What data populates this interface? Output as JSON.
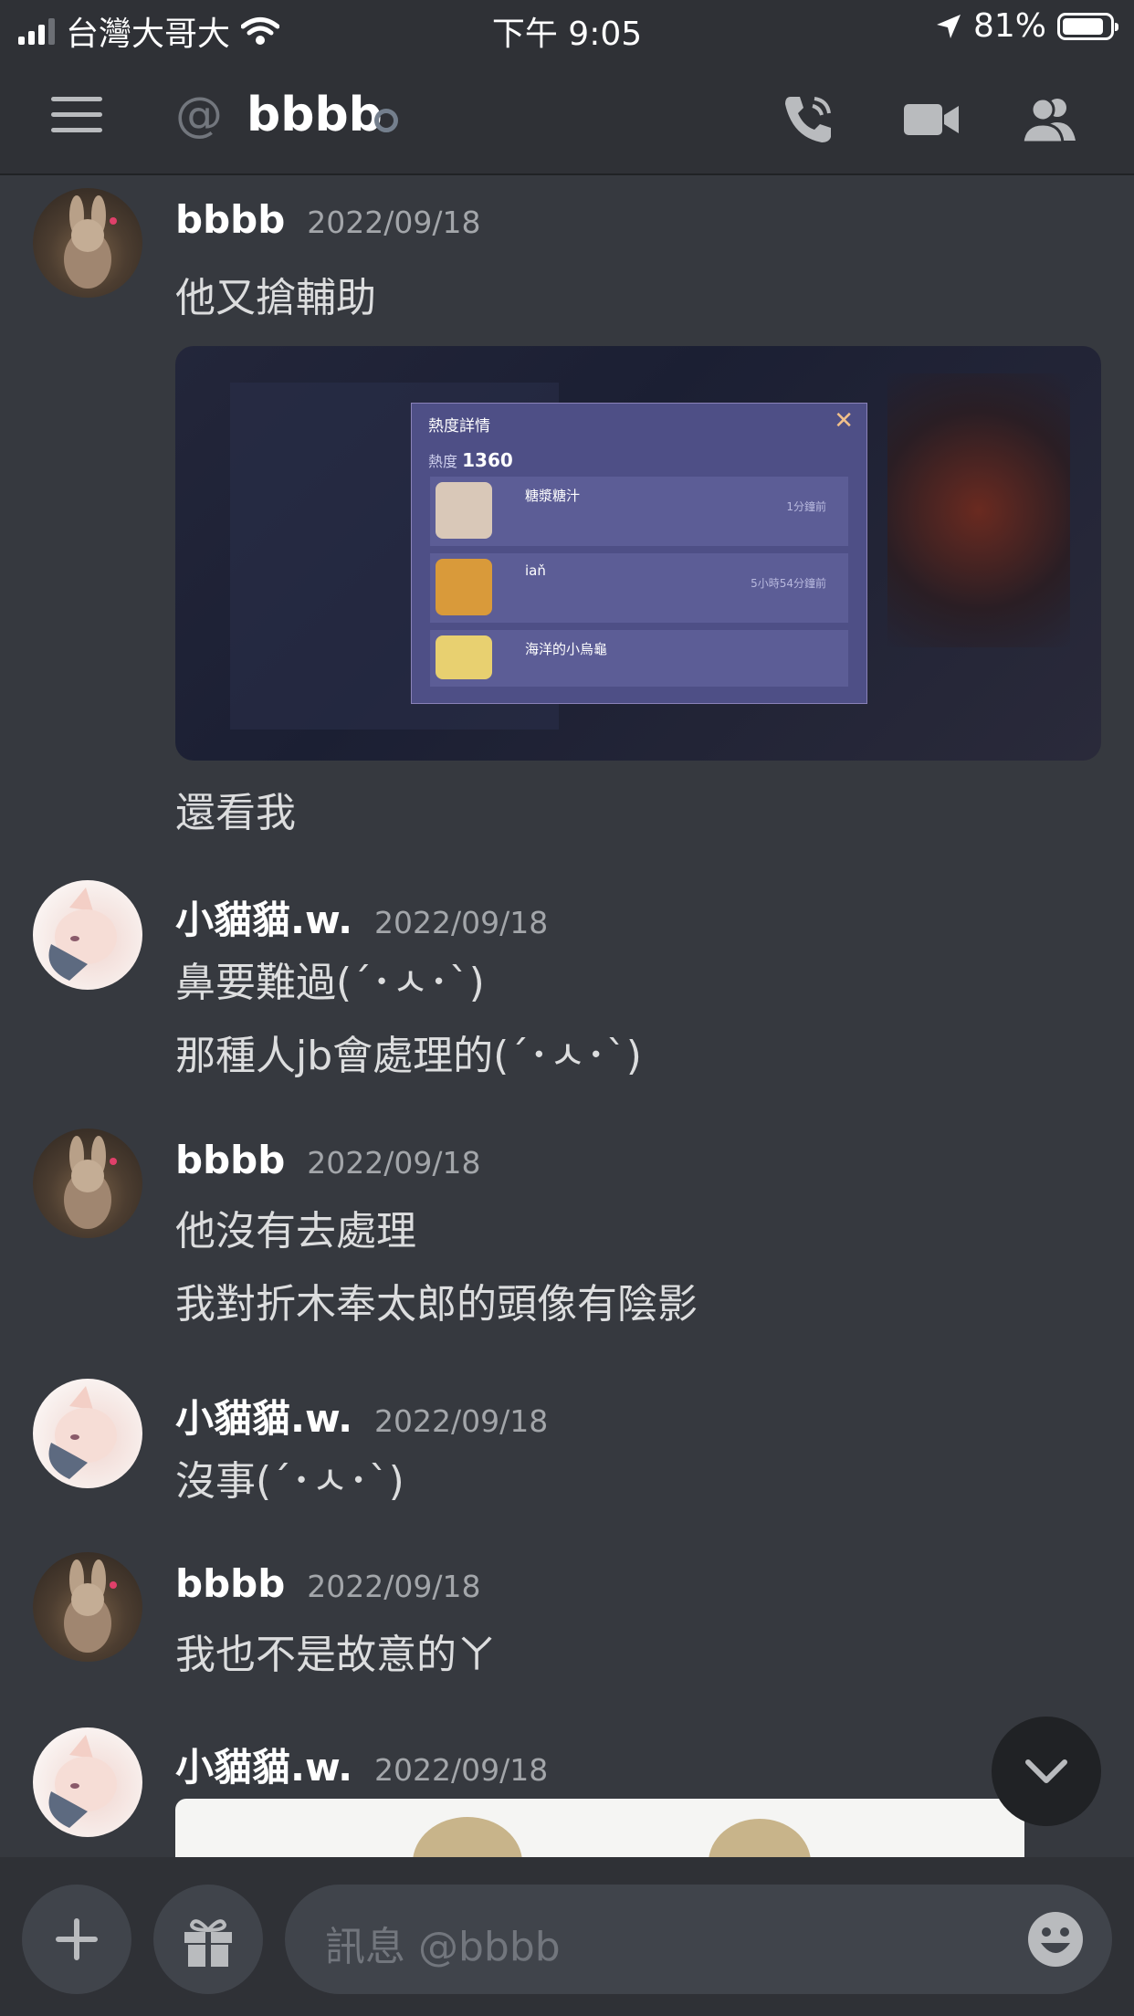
{
  "status_bar": {
    "carrier": "台灣大哥大",
    "time": "下午 9:05",
    "battery": "81%"
  },
  "header": {
    "channel_name": "bbbb"
  },
  "messages": [
    {
      "author": "bbbb",
      "timestamp": "2022/09/18",
      "lines": [
        "他又搶輔助"
      ],
      "after_image": "還看我"
    },
    {
      "author": "小貓貓.w.",
      "timestamp": "2022/09/18",
      "lines": [
        "鼻要難過(´･ㅅ･`)",
        "那種人jb會處理的(´･ㅅ･`)"
      ]
    },
    {
      "author": "bbbb",
      "timestamp": "2022/09/18",
      "lines": [
        "他沒有去處理",
        "我對折木奉太郎的頭像有陰影"
      ]
    },
    {
      "author": "小貓貓.w.",
      "timestamp": "2022/09/18",
      "lines": [
        "沒事(´･ㅅ･`)"
      ]
    },
    {
      "author": "bbbb",
      "timestamp": "2022/09/18",
      "lines": [
        "我也不是故意的ㄚ"
      ]
    },
    {
      "author": "小貓貓.w.",
      "timestamp": "2022/09/18",
      "lines": []
    }
  ],
  "embed_popup": {
    "title": "熱度詳情",
    "heat_label": "熱度",
    "heat_value": "1360",
    "rows": [
      {
        "name": "糖漿糖汁",
        "time": "1分鐘前"
      },
      {
        "name": "iaň",
        "time": "5小時54分鐘前"
      },
      {
        "name": "海洋的小烏龜",
        "time": ""
      }
    ]
  },
  "composer": {
    "placeholder": "訊息 @bbbb"
  },
  "colors": {
    "background": "#36393f",
    "header": "#2f3136",
    "input": "#40444b"
  }
}
